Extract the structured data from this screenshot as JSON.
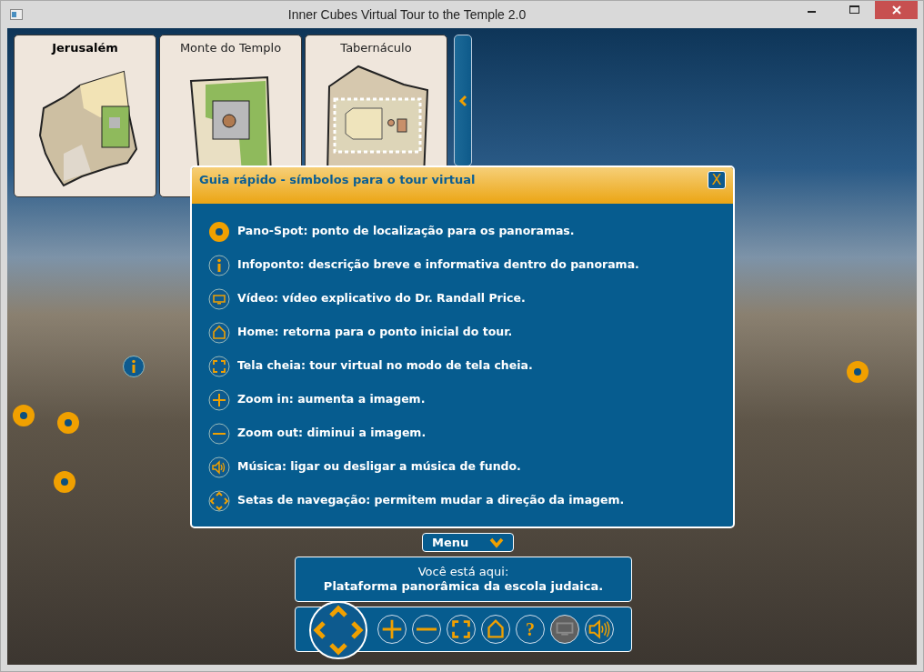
{
  "window": {
    "title": "Inner Cubes Virtual Tour to the Temple 2.0"
  },
  "map_tabs": [
    {
      "label": "Jerusalém",
      "selected": true,
      "kind": "city"
    },
    {
      "label": "Monte do Templo",
      "selected": false,
      "kind": "mount"
    },
    {
      "label": "Tabernáculo",
      "selected": false,
      "kind": "tabernacle"
    }
  ],
  "quick_guide": {
    "title": "Guia rápido - símbolos para o tour virtual",
    "close_label": "X",
    "items": [
      {
        "kind": "pano",
        "text": "Pano-Spot: ponto de localização para os panoramas."
      },
      {
        "kind": "info",
        "text": "Infoponto: descrição breve e informativa dentro do panorama."
      },
      {
        "kind": "video",
        "text": "Vídeo: vídeo explicativo do Dr. Randall Price."
      },
      {
        "kind": "home",
        "text": "Home: retorna para o ponto inicial do tour."
      },
      {
        "kind": "fullscreen",
        "text": "Tela cheia: tour virtual no modo de tela cheia."
      },
      {
        "kind": "zoomin",
        "text": "Zoom in: aumenta a imagem."
      },
      {
        "kind": "zoomout",
        "text": "Zoom out: diminui a imagem."
      },
      {
        "kind": "sound",
        "text": "Música: ligar ou desligar a música de fundo."
      },
      {
        "kind": "nav",
        "text": "Setas de navegação: permitem mudar a direção da imagem."
      }
    ]
  },
  "menu_button": {
    "label": "Menu"
  },
  "location": {
    "caption": "Você está aqui:",
    "place": "Plataforma panorâmica da escola judaica."
  },
  "controls": [
    {
      "kind": "zoomin",
      "disabled": false
    },
    {
      "kind": "zoomout",
      "disabled": false
    },
    {
      "kind": "fullscreen",
      "disabled": false
    },
    {
      "kind": "home",
      "disabled": false
    },
    {
      "kind": "help",
      "label": "?",
      "disabled": false
    },
    {
      "kind": "video",
      "disabled": true
    },
    {
      "kind": "sound",
      "disabled": false
    }
  ]
}
